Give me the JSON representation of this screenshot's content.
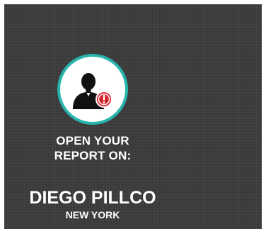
{
  "report": {
    "icon": "user-alert-icon",
    "headline_line1": "OPEN YOUR",
    "headline_line2": "REPORT ON:",
    "name": "DIEGO PILLCO",
    "location": "NEW YORK"
  },
  "colors": {
    "card_background": "#3a3a3a",
    "ring": "#27b5ad",
    "alert": "#d61f26",
    "text": "#ffffff"
  }
}
